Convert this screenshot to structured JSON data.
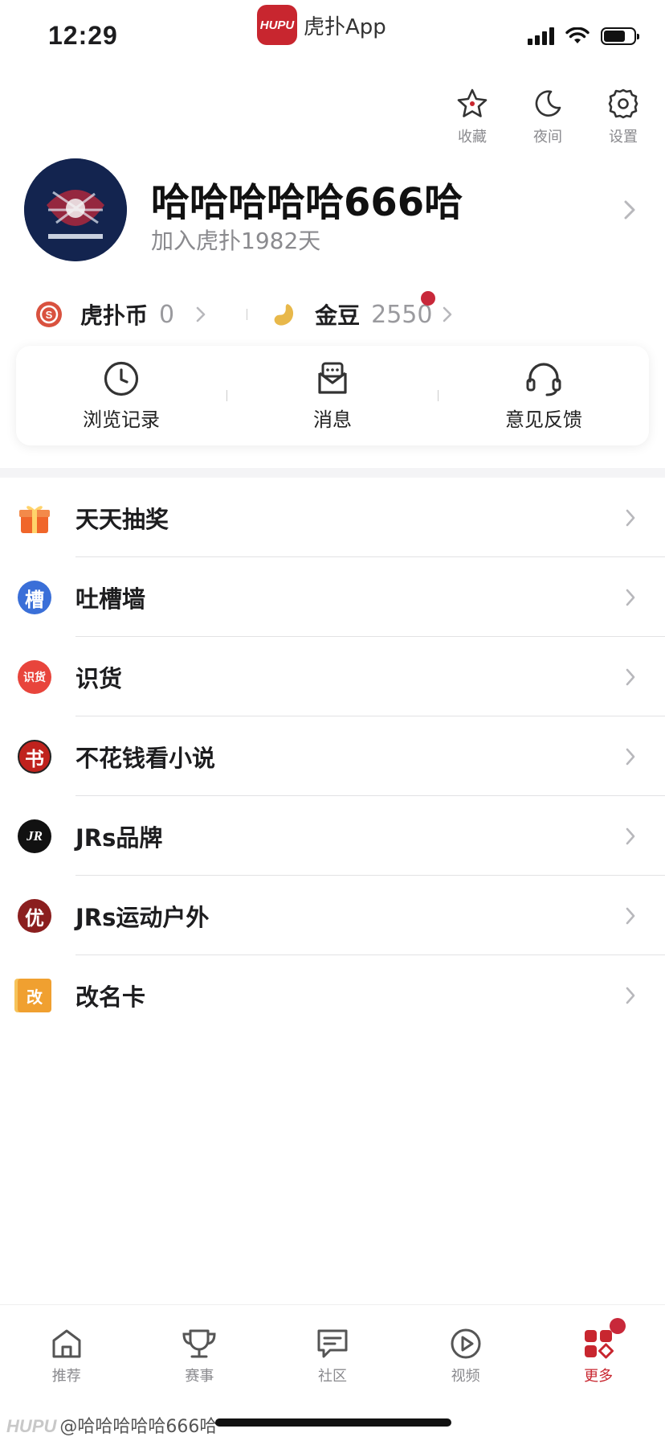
{
  "status_bar": {
    "time": "12:29",
    "app_logo_text": "HUPU",
    "app_name": "虎扑App"
  },
  "top_actions": [
    {
      "label": "收藏",
      "icon": "star-icon"
    },
    {
      "label": "夜间",
      "icon": "moon-icon"
    },
    {
      "label": "设置",
      "icon": "gear-icon"
    }
  ],
  "profile": {
    "username": "哈哈哈哈哈666哈",
    "joined": "加入虎扑1982天"
  },
  "coins": {
    "hupu_coin": {
      "label": "虎扑币",
      "value": "0"
    },
    "gold_bean": {
      "label": "金豆",
      "value": "2550"
    }
  },
  "quick_actions": [
    {
      "label": "浏览记录",
      "icon": "clock-icon"
    },
    {
      "label": "消息",
      "icon": "message-icon"
    },
    {
      "label": "意见反馈",
      "icon": "headset-icon"
    }
  ],
  "menu": [
    {
      "label": "天天抽奖",
      "icon": "gift-icon",
      "glyph": "",
      "color": "#f0662a"
    },
    {
      "label": "吐槽墙",
      "icon": "complain-wall-icon",
      "glyph": "槽",
      "color": "#3a6fd8"
    },
    {
      "label": "识货",
      "icon": "shihuo-icon",
      "glyph": "识货",
      "color": "#e8453c"
    },
    {
      "label": "不花钱看小说",
      "icon": "book-icon",
      "glyph": "书",
      "color": "#c0221d"
    },
    {
      "label": "JRs品牌",
      "icon": "jrs-brand-icon",
      "glyph": "JR",
      "color": "#111111"
    },
    {
      "label": "JRs运动户外",
      "icon": "jrs-outdoor-icon",
      "glyph": "优",
      "color": "#8b1f1f"
    },
    {
      "label": "改名卡",
      "icon": "rename-card-icon",
      "glyph": "改",
      "color": "#f0a030"
    }
  ],
  "tabbar": [
    {
      "label": "推荐",
      "icon": "home-icon",
      "active": false
    },
    {
      "label": "赛事",
      "icon": "trophy-icon",
      "active": false
    },
    {
      "label": "社区",
      "icon": "chat-icon",
      "active": false
    },
    {
      "label": "视频",
      "icon": "play-icon",
      "active": false
    },
    {
      "label": "更多",
      "icon": "more-grid-icon",
      "active": true
    }
  ],
  "watermark": {
    "brand": "HUPU",
    "handle": "@哈哈哈哈哈666哈"
  },
  "colors": {
    "accent": "#c8262f",
    "badge": "#c8283a"
  }
}
